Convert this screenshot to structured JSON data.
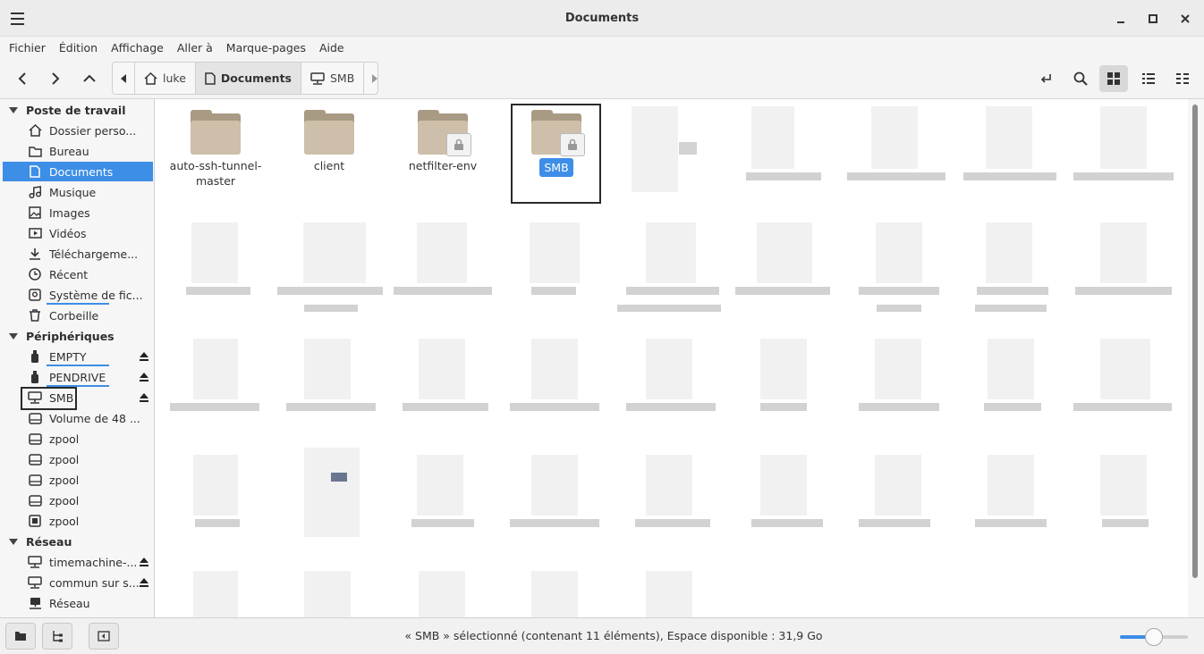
{
  "window": {
    "title": "Documents"
  },
  "menu": [
    "Fichier",
    "Édition",
    "Affichage",
    "Aller à",
    "Marque-pages",
    "Aide"
  ],
  "breadcrumbs": [
    {
      "label": "luke",
      "icon": "home-icon"
    },
    {
      "label": "Documents",
      "icon": "document-icon",
      "active": true
    },
    {
      "label": "SMB",
      "icon": "network-drive-icon"
    }
  ],
  "sidebar": {
    "sections": [
      {
        "title": "Poste de travail",
        "items": [
          {
            "label": "Dossier perso...",
            "icon": "home-icon"
          },
          {
            "label": "Bureau",
            "icon": "folder-icon"
          },
          {
            "label": "Documents",
            "icon": "document-icon",
            "selected": true
          },
          {
            "label": "Musique",
            "icon": "music-icon"
          },
          {
            "label": "Images",
            "icon": "image-icon"
          },
          {
            "label": "Vidéos",
            "icon": "video-icon"
          },
          {
            "label": "Téléchargeme...",
            "icon": "download-icon"
          },
          {
            "label": "Récent",
            "icon": "clock-icon"
          },
          {
            "label": "Système de fic...",
            "icon": "drive-icon",
            "usage": 0.7
          },
          {
            "label": "Corbeille",
            "icon": "trash-icon"
          }
        ]
      },
      {
        "title": "Périphériques",
        "items": [
          {
            "label": "EMPTY",
            "icon": "usb-icon",
            "eject": true,
            "usage": 0.7
          },
          {
            "label": "PENDRIVE",
            "icon": "usb-icon",
            "eject": true,
            "usage": 0.7
          },
          {
            "label": "SMB",
            "icon": "network-drive-icon",
            "eject": true,
            "boxed": true
          },
          {
            "label": "Volume de 48 ...",
            "icon": "disk-icon"
          },
          {
            "label": "zpool",
            "icon": "disk-icon"
          },
          {
            "label": "zpool",
            "icon": "disk-icon"
          },
          {
            "label": "zpool",
            "icon": "disk-icon"
          },
          {
            "label": "zpool",
            "icon": "disk-icon"
          },
          {
            "label": "zpool",
            "icon": "chip-icon"
          }
        ]
      },
      {
        "title": "Réseau",
        "items": [
          {
            "label": "timemachine-...",
            "icon": "network-drive-icon",
            "eject": true
          },
          {
            "label": "commun sur s...",
            "icon": "network-drive-icon",
            "eject": true
          },
          {
            "label": "Réseau",
            "icon": "network-icon"
          }
        ]
      }
    ]
  },
  "files": [
    {
      "label": "auto-ssh-tunnel-master",
      "locked": false
    },
    {
      "label": "client",
      "locked": false
    },
    {
      "label": "netfilter-env",
      "locked": true
    },
    {
      "label": "SMB",
      "locked": true,
      "selected": true
    }
  ],
  "status": {
    "text": "« SMB » sélectionné (contenant 11 éléments), Espace disponible : 31,9 Go"
  },
  "zoom": {
    "level": 0.5
  },
  "colors": {
    "accent": "#3d8ee6",
    "folder": "#cdbfa9"
  }
}
